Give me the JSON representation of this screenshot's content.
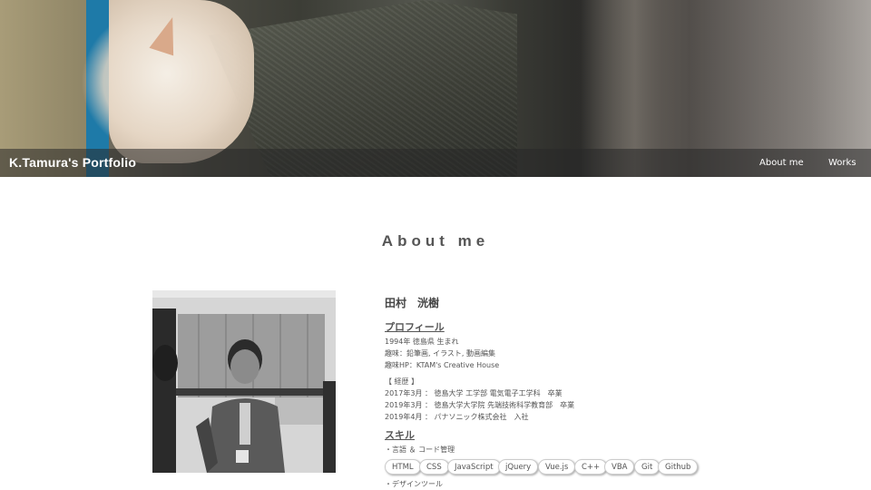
{
  "header": {
    "brand": "K.Tamura's Portfolio",
    "nav": [
      {
        "label": "About me"
      },
      {
        "label": "Works"
      }
    ]
  },
  "about": {
    "section_title": "About me",
    "name": "田村　洸樹",
    "profile_heading": "プロフィール",
    "profile_lines": [
      "1994年 徳島県 生まれ",
      "趣味：鉛筆画, イラスト, 動画編集",
      "趣味HP：KTAM's Creative House"
    ],
    "career_heading": "【 経歴 】",
    "career_lines": [
      "2017年3月 ： 徳島大学 工学部 電気電子工学科　卒業",
      "2019年3月 ： 徳島大学大学院 先端技術科学教育部　卒業",
      "2019年4月 ： パナソニック株式会社　入社"
    ],
    "skill_heading": "スキル",
    "skill_language_label": "・言語 ＆ コード管理",
    "skills": [
      "HTML",
      "CSS",
      "JavaScript",
      "jQuery",
      "Vue.js",
      "C++",
      "VBA",
      "Git",
      "Github"
    ],
    "design_tools_label": "・デザインツール"
  },
  "colors": {
    "accent_text": "#555555",
    "navbar_overlay": "rgba(40,40,40,0.55)"
  }
}
